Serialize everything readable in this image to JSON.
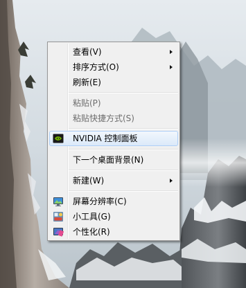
{
  "context_menu": {
    "items": [
      {
        "label": "查看(V)"
      },
      {
        "label": "排序方式(O)"
      },
      {
        "label": "刷新(E)"
      },
      {
        "label": "粘贴(P)"
      },
      {
        "label": "粘贴快捷方式(S)"
      },
      {
        "label": "NVIDIA 控制面板"
      },
      {
        "label": "下一个桌面背景(N)"
      },
      {
        "label": "新建(W)"
      },
      {
        "label": "屏幕分辨率(C)"
      },
      {
        "label": "小工具(G)"
      },
      {
        "label": "个性化(R)"
      }
    ],
    "icons": {
      "nvidia": "nvidia-logo-icon",
      "resolution": "monitor-icon",
      "gadgets": "gadgets-icon",
      "personalize": "personalize-icon"
    },
    "colors": {
      "menu_background": "#f0f0f0",
      "hover_border": "#aecff7",
      "disabled_text": "#6d6d6d",
      "nvidia_green": "#76b900"
    }
  }
}
